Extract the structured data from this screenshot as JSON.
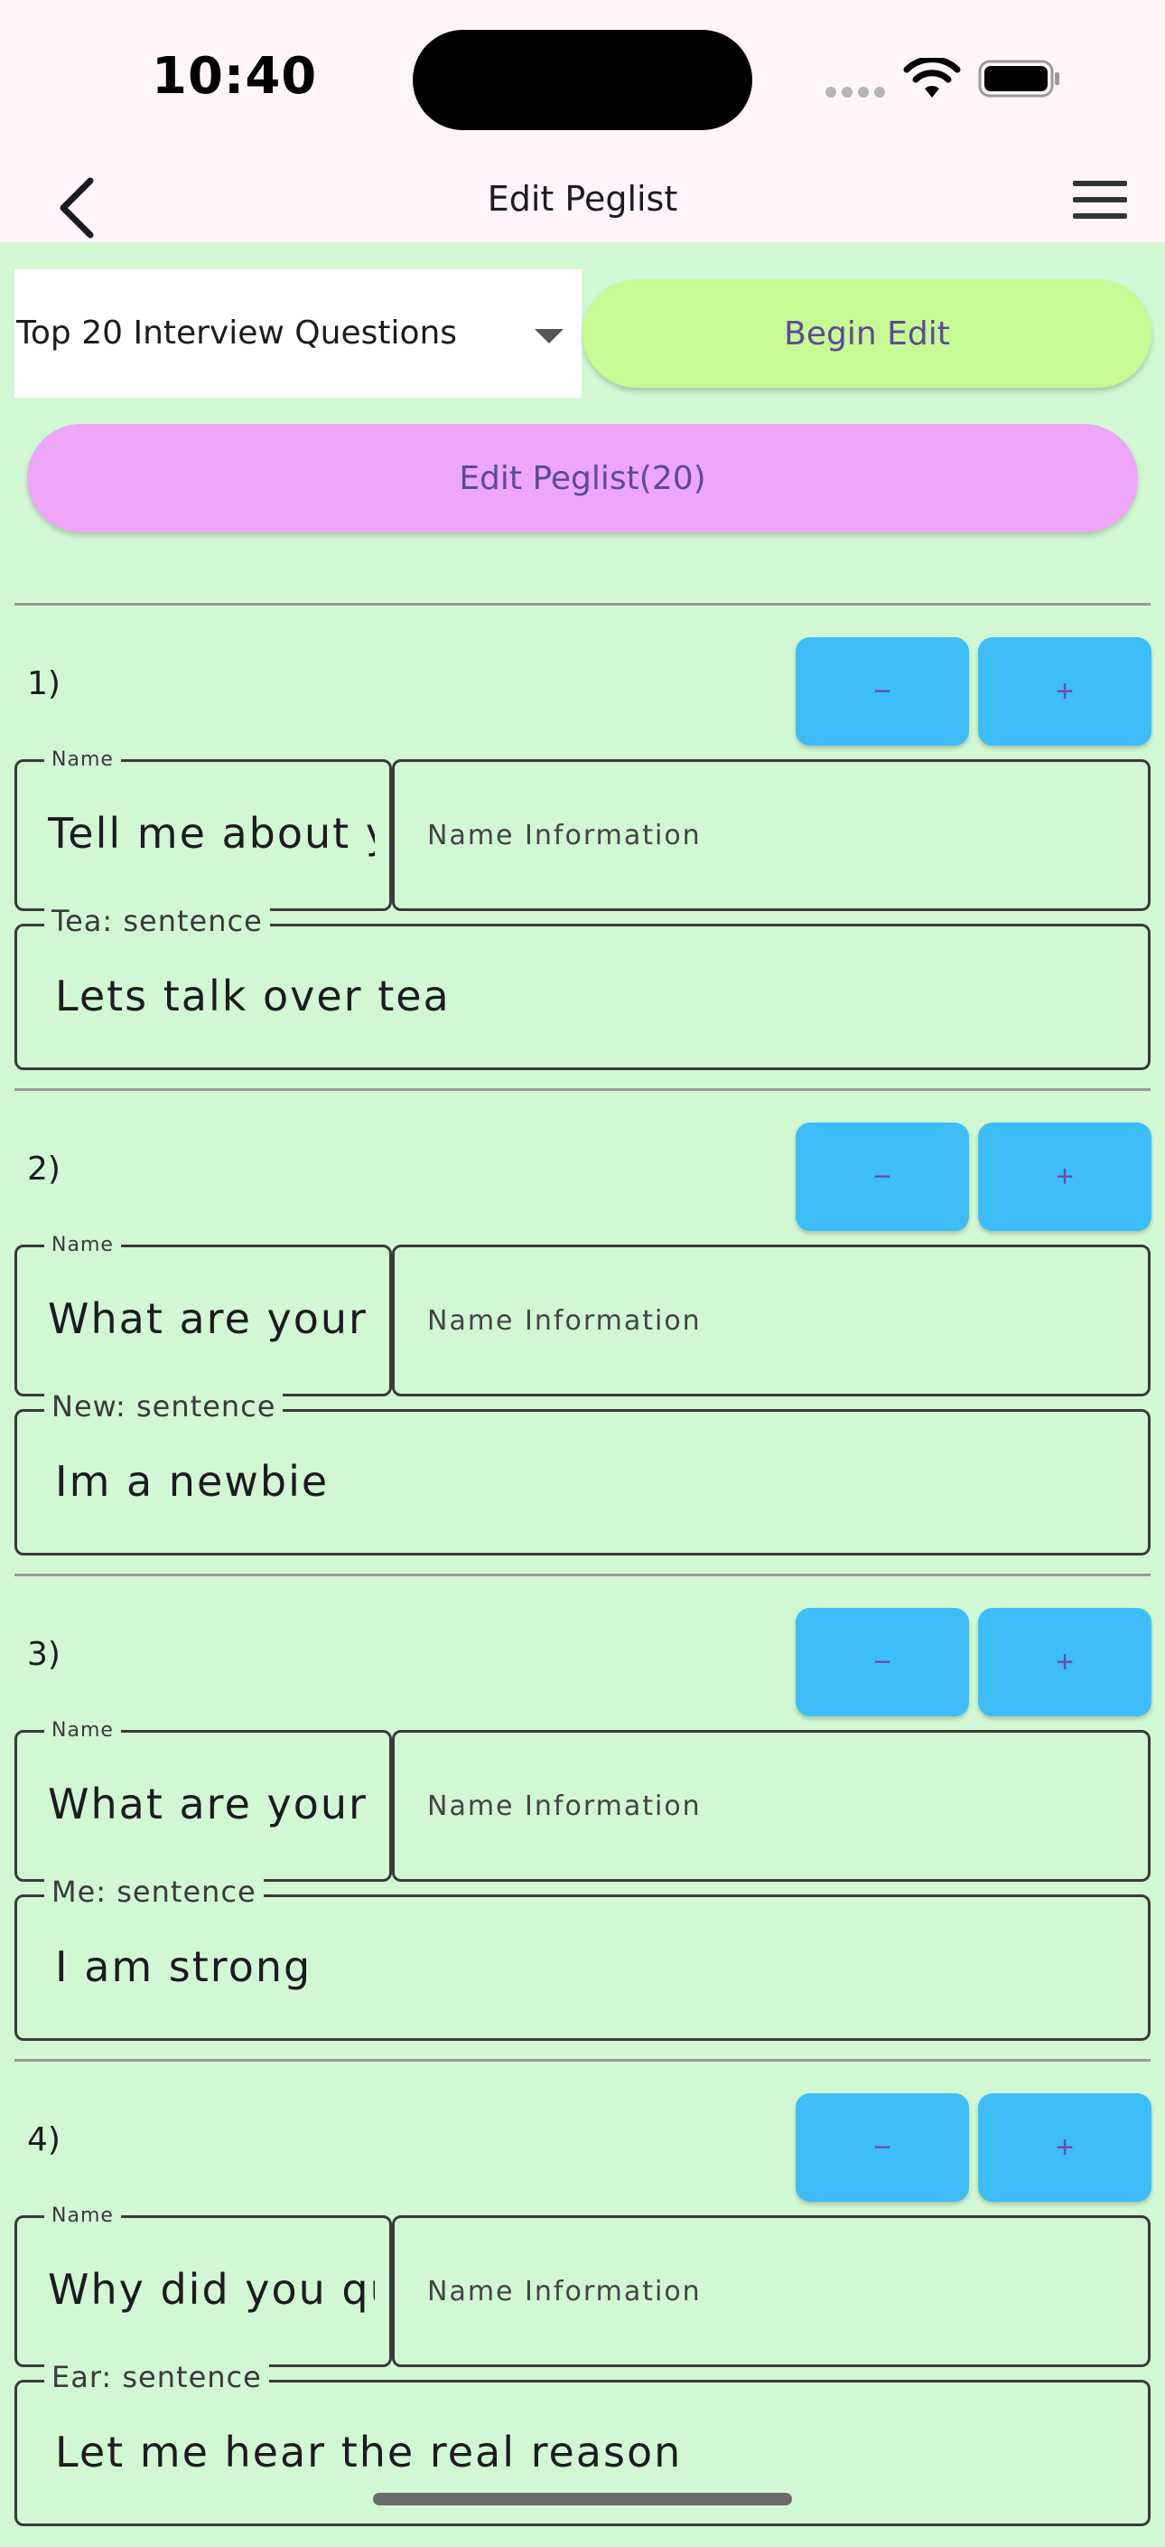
{
  "status_bar": {
    "time": "10:40"
  },
  "app_bar": {
    "title": "Edit Peglist"
  },
  "controls": {
    "peglist_selected": "Top 20 Interview Questions",
    "begin_edit_label": "Begin Edit",
    "edit_peglist_label": "Edit Peglist(20)"
  },
  "labels": {
    "name": "Name",
    "name_info_placeholder": "Name Information",
    "minus": "−",
    "plus": "+"
  },
  "items": [
    {
      "number": "1)",
      "name": "Tell me about yourself",
      "sentence_label": "Tea: sentence",
      "sentence": "Lets talk over tea"
    },
    {
      "number": "2)",
      "name": "What are your strengths",
      "sentence_label": "New: sentence",
      "sentence": "Im a newbie"
    },
    {
      "number": "3)",
      "name": "What are your weaknesses",
      "sentence_label": "Me: sentence",
      "sentence": "I am strong"
    },
    {
      "number": "4)",
      "name": "Why did you quit",
      "sentence_label": "Ear: sentence",
      "sentence": "Let me hear the real reason"
    }
  ],
  "colors": {
    "background": "#d2f8d3",
    "begin_edit": "#c7f994",
    "edit_peglist": "#eda6f9",
    "stepper": "#3dbefb"
  }
}
